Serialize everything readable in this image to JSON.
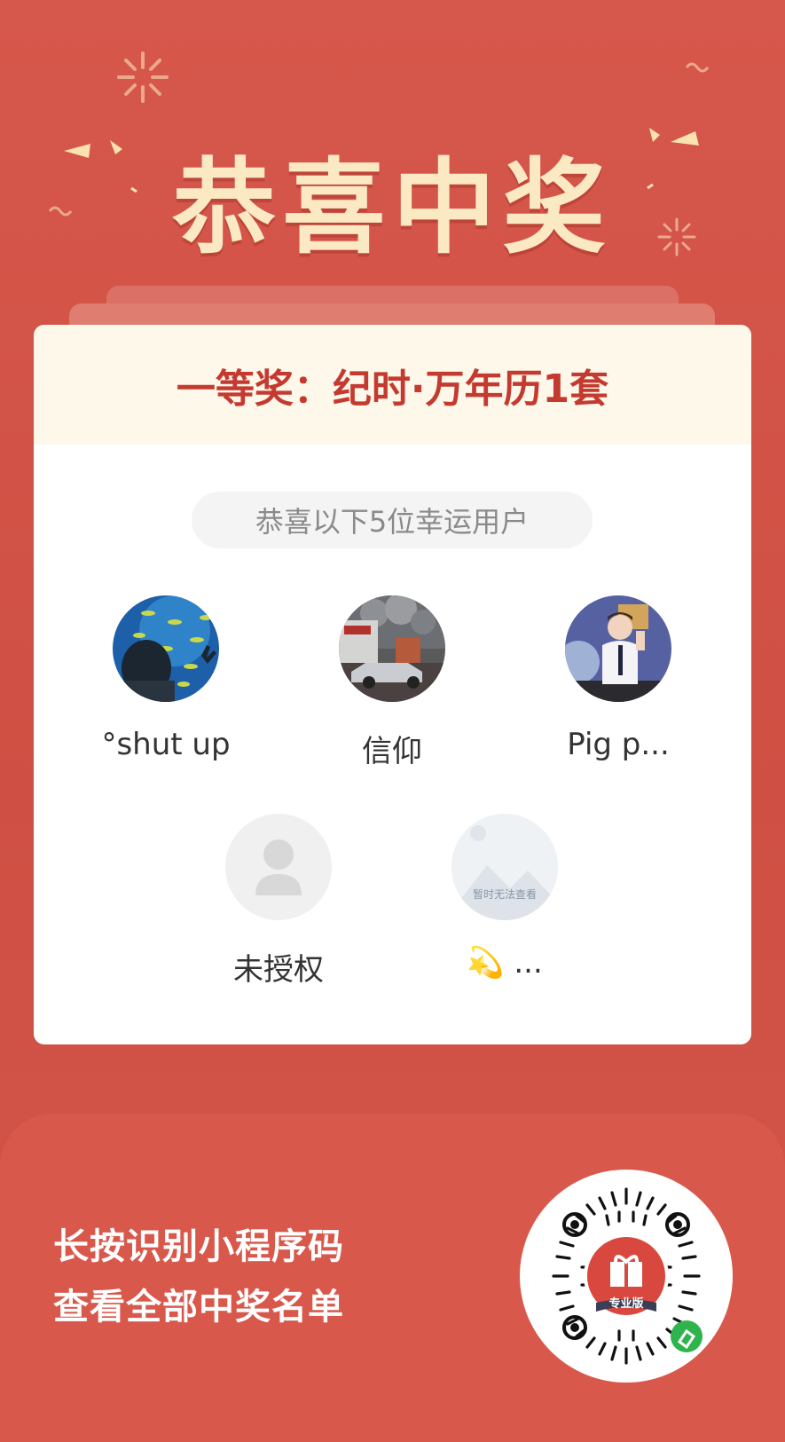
{
  "header": {
    "title": "恭喜中奖"
  },
  "card": {
    "prize_label": "一等奖：纪时·万年历1套",
    "lucky_text": "恭喜以下5位幸运用户",
    "winners": [
      {
        "name": "°shut up",
        "avatar": "aquarium-photo-avatar"
      },
      {
        "name": "信仰",
        "avatar": "car-photo-avatar"
      },
      {
        "name": "Pig p...",
        "avatar": "office-photo-avatar"
      },
      {
        "name": "未授权",
        "avatar": "default-user-avatar"
      },
      {
        "name": "💫 ...",
        "avatar": "image-unavailable-avatar",
        "avatar_text": "暂时无法查看"
      }
    ]
  },
  "footer": {
    "line1": "长按识别小程序码",
    "line2": "查看全部中奖名单",
    "qr_badge": "专业版"
  },
  "colors": {
    "background": "#d2544a",
    "headline": "#fbe9c4",
    "prize_text": "#c43a30",
    "banner_bg": "#fdf8ea"
  }
}
